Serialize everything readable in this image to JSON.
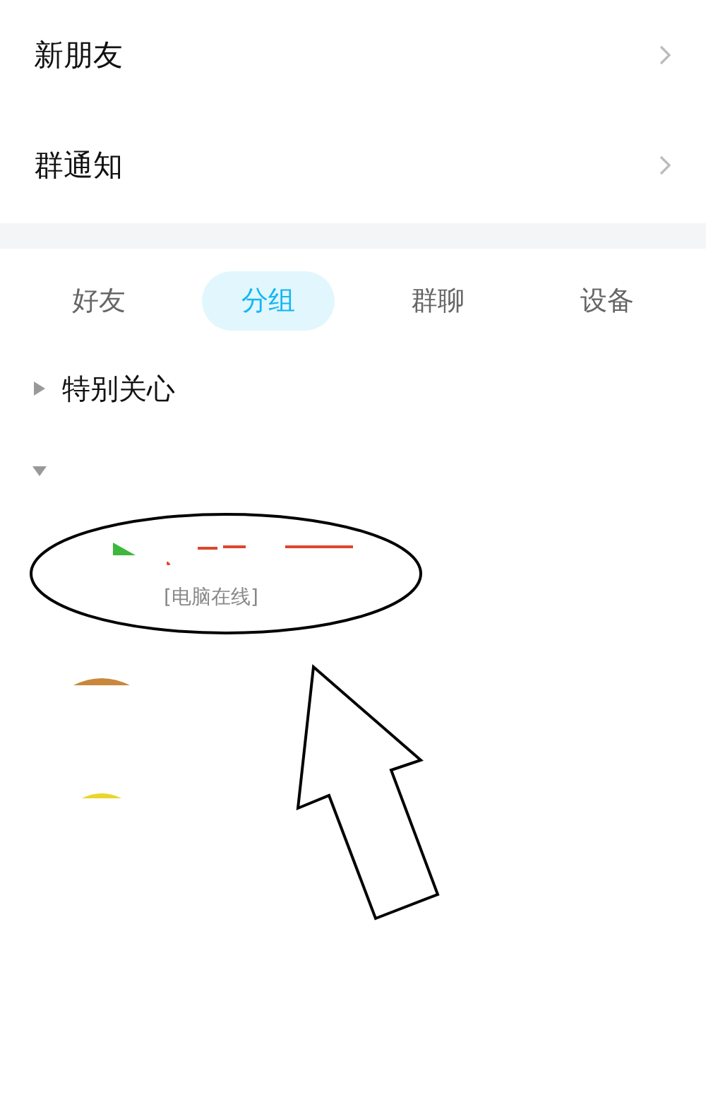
{
  "menu": [
    {
      "label": "新朋友"
    },
    {
      "label": "群通知"
    }
  ],
  "tabs": [
    {
      "label": "好友",
      "selected": false
    },
    {
      "label": "分组",
      "selected": true
    },
    {
      "label": "群聊",
      "selected": false
    },
    {
      "label": "设备",
      "selected": false
    }
  ],
  "groups": [
    {
      "label": "特别关心",
      "expanded": false
    },
    {
      "expanded": true,
      "contacts": [
        {
          "status": "[电脑在线]"
        }
      ]
    }
  ]
}
